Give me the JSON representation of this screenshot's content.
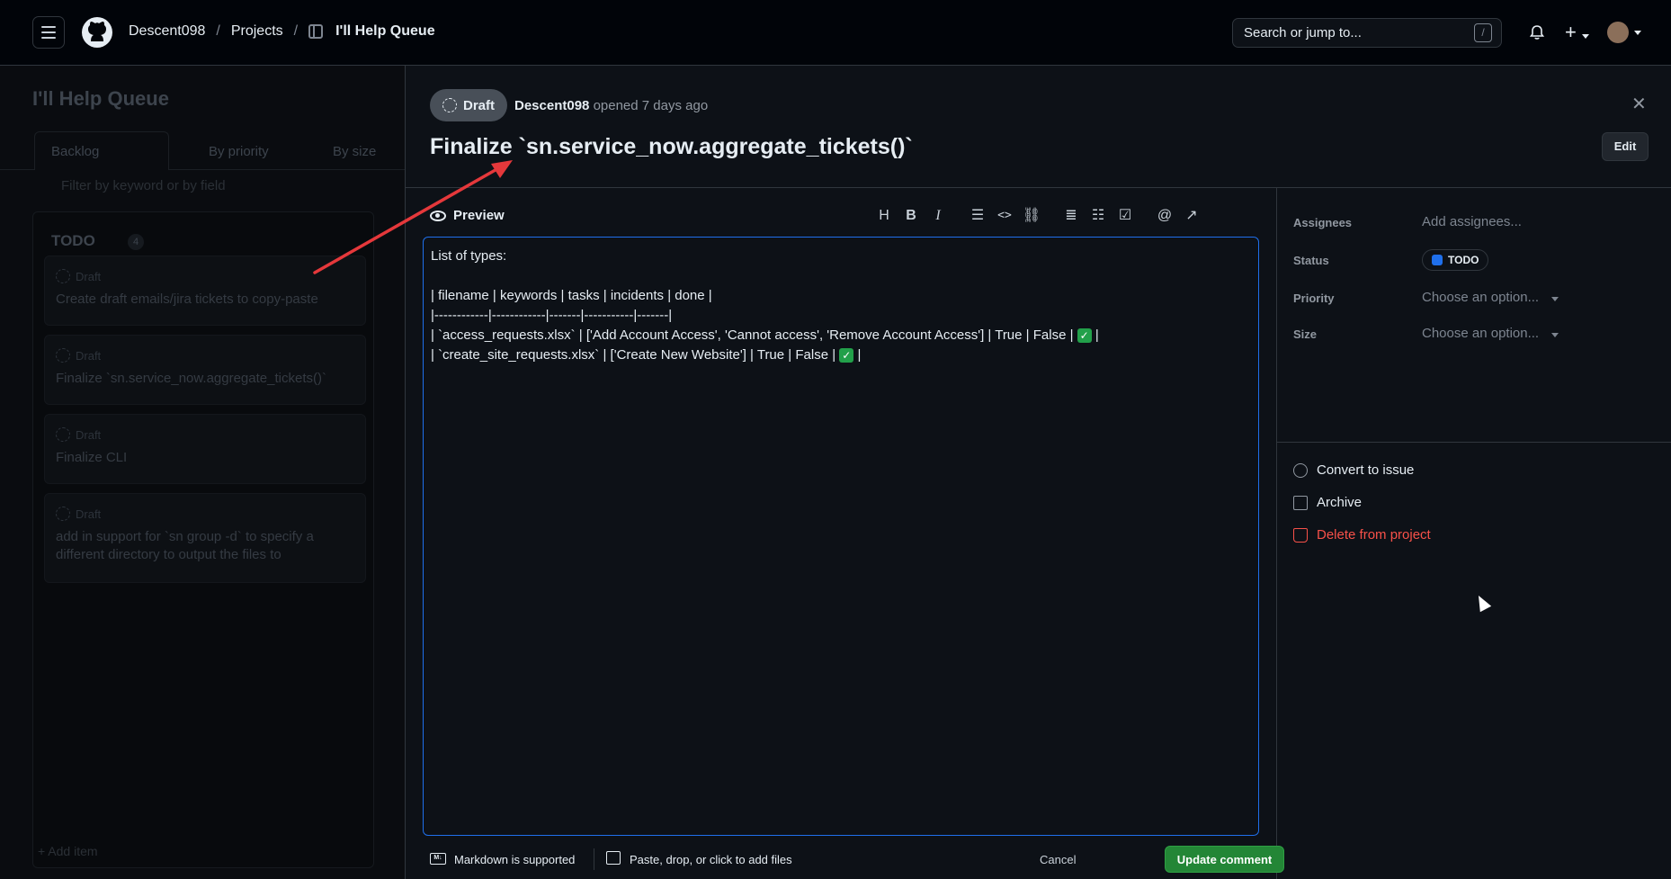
{
  "topbar": {
    "breadcrumb": [
      "Descent098",
      "Projects",
      "I'll Help Queue"
    ],
    "separator": "/",
    "search_placeholder": "Search or jump to...",
    "search_shortcut": "/",
    "plus": "+"
  },
  "board": {
    "title": "I'll Help Queue",
    "tabs": [
      "Backlog",
      "By priority",
      "By size"
    ],
    "filter_placeholder": "Filter by keyword or by field",
    "column": {
      "name": "TODO",
      "count": "4",
      "cards": [
        {
          "status": "Draft",
          "text": "Create draft emails/jira tickets to copy-paste"
        },
        {
          "status": "Draft",
          "text": "Finalize `sn.service_now.aggregate_tickets()`"
        },
        {
          "status": "Draft",
          "text": "Finalize CLI"
        },
        {
          "status": "Draft",
          "text": "add in support for `sn group -d` to specify a different directory to output the files to"
        }
      ],
      "add_item": "Add item"
    }
  },
  "panel": {
    "badge": "Draft",
    "author": "Descent098",
    "opened": "opened 7 days ago",
    "close": "✕",
    "title": "Finalize `sn.service_now.aggregate_tickets()`",
    "edit_label": "Edit",
    "editor": {
      "preview_label": "Preview",
      "toolbar": [
        "H",
        "B",
        "I",
        "quote",
        "code",
        "link",
        "ul",
        "ol",
        "task",
        "@",
        "ref"
      ],
      "lines": [
        "List of types:",
        "",
        "| filename | keywords | tasks | incidents | done |",
        "|------------|------------|-------|-----------|-------|",
        "| `access_requests.xlsx` | ['Add Account Access', 'Cannot access', 'Remove Account Access'] | True | False | ",
        "| `create_site_requests.xlsx` | ['Create New Website'] | True | False | "
      ],
      "check_glyph": "✓",
      "trailing_pipe": "|"
    },
    "footer": {
      "markdown_icon": "M↓",
      "markdown_note": "Markdown is supported",
      "files_note": "Paste, drop, or click to add files",
      "cancel": "Cancel",
      "update": "Update comment"
    },
    "sidebar": {
      "assignees_label": "Assignees",
      "assignees_value": "Add assignees...",
      "status_label": "Status",
      "status_value": "TODO",
      "priority_label": "Priority",
      "priority_value": "Choose an option...",
      "size_label": "Size",
      "size_value": "Choose an option...",
      "actions": [
        "Convert to issue",
        "Archive",
        "Delete from project"
      ]
    }
  },
  "colors": {
    "accent_blue": "#1f6feb",
    "success_green": "#238636",
    "danger_red": "#f85149",
    "annotation_arrow": "#e5383b"
  }
}
